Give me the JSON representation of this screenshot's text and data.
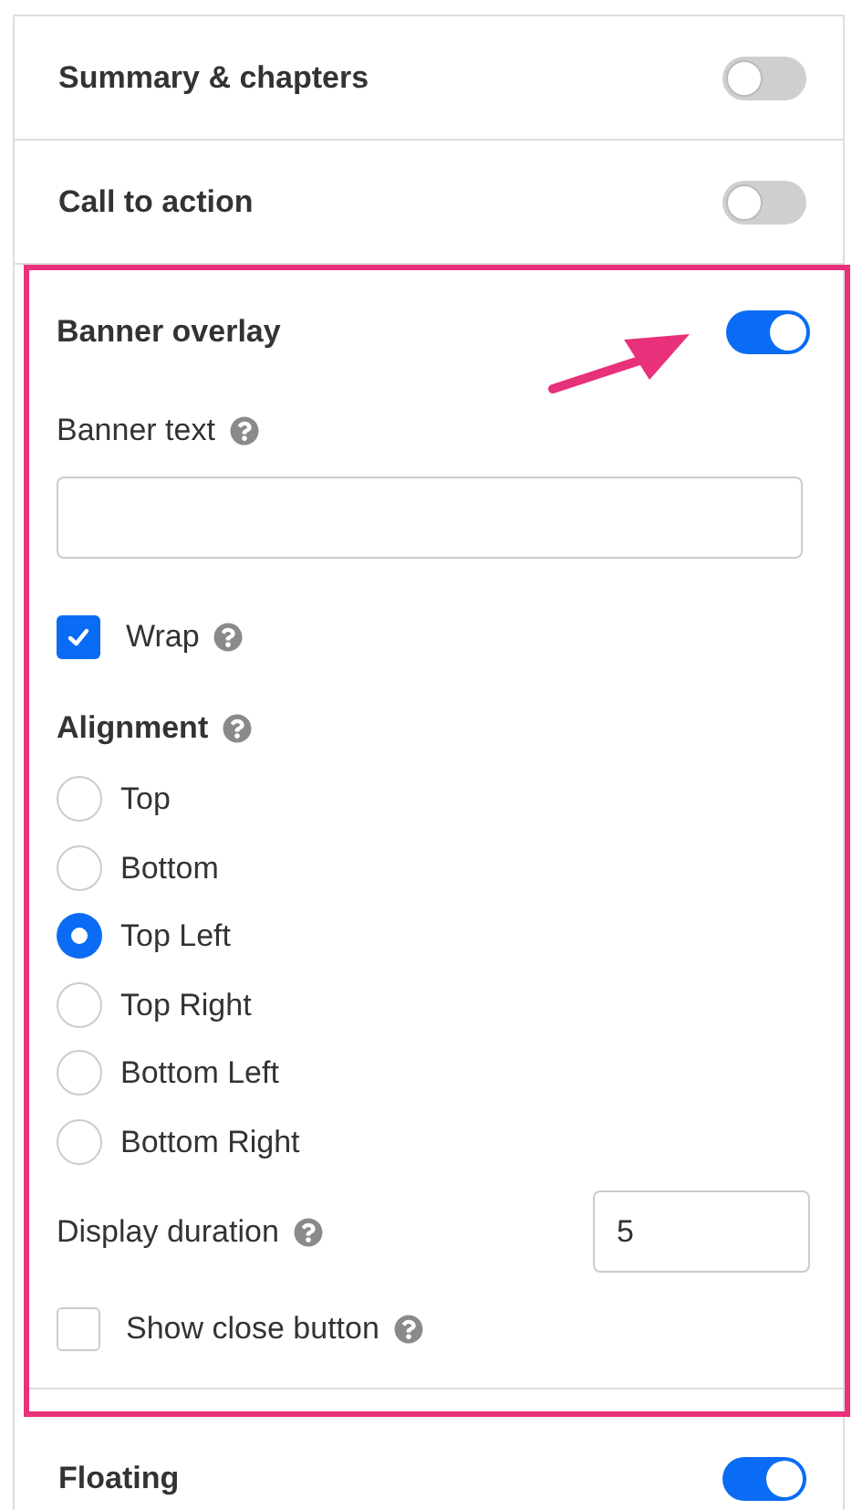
{
  "sections": [
    {
      "title": "Summary & chapters",
      "on": false,
      "highlighted": false
    },
    {
      "title": "Call to action",
      "on": false,
      "highlighted": false
    },
    {
      "title": "Banner overlay",
      "on": true,
      "highlighted": true,
      "pointer_arrow": true,
      "fields": [
        {
          "kind": "text_input",
          "label": "Banner text",
          "help": true
        },
        {
          "kind": "checkbox",
          "label": "Wrap",
          "checked": true,
          "help": true
        },
        {
          "kind": "radio_group",
          "label": "Alignment",
          "help": true,
          "options": [
            {
              "label": "Top",
              "selected": false
            },
            {
              "label": "Bottom",
              "selected": false
            },
            {
              "label": "Top Left",
              "selected": true
            },
            {
              "label": "Top Right",
              "selected": false
            },
            {
              "label": "Bottom Left",
              "selected": false
            },
            {
              "label": "Bottom Right",
              "selected": false
            }
          ]
        },
        {
          "kind": "number_input",
          "label": "Display duration",
          "help": true,
          "value": "5"
        },
        {
          "kind": "checkbox",
          "label": "Show close button",
          "checked": false,
          "help": true
        }
      ]
    },
    {
      "title": "Floating",
      "on": true,
      "highlighted": false
    }
  ]
}
